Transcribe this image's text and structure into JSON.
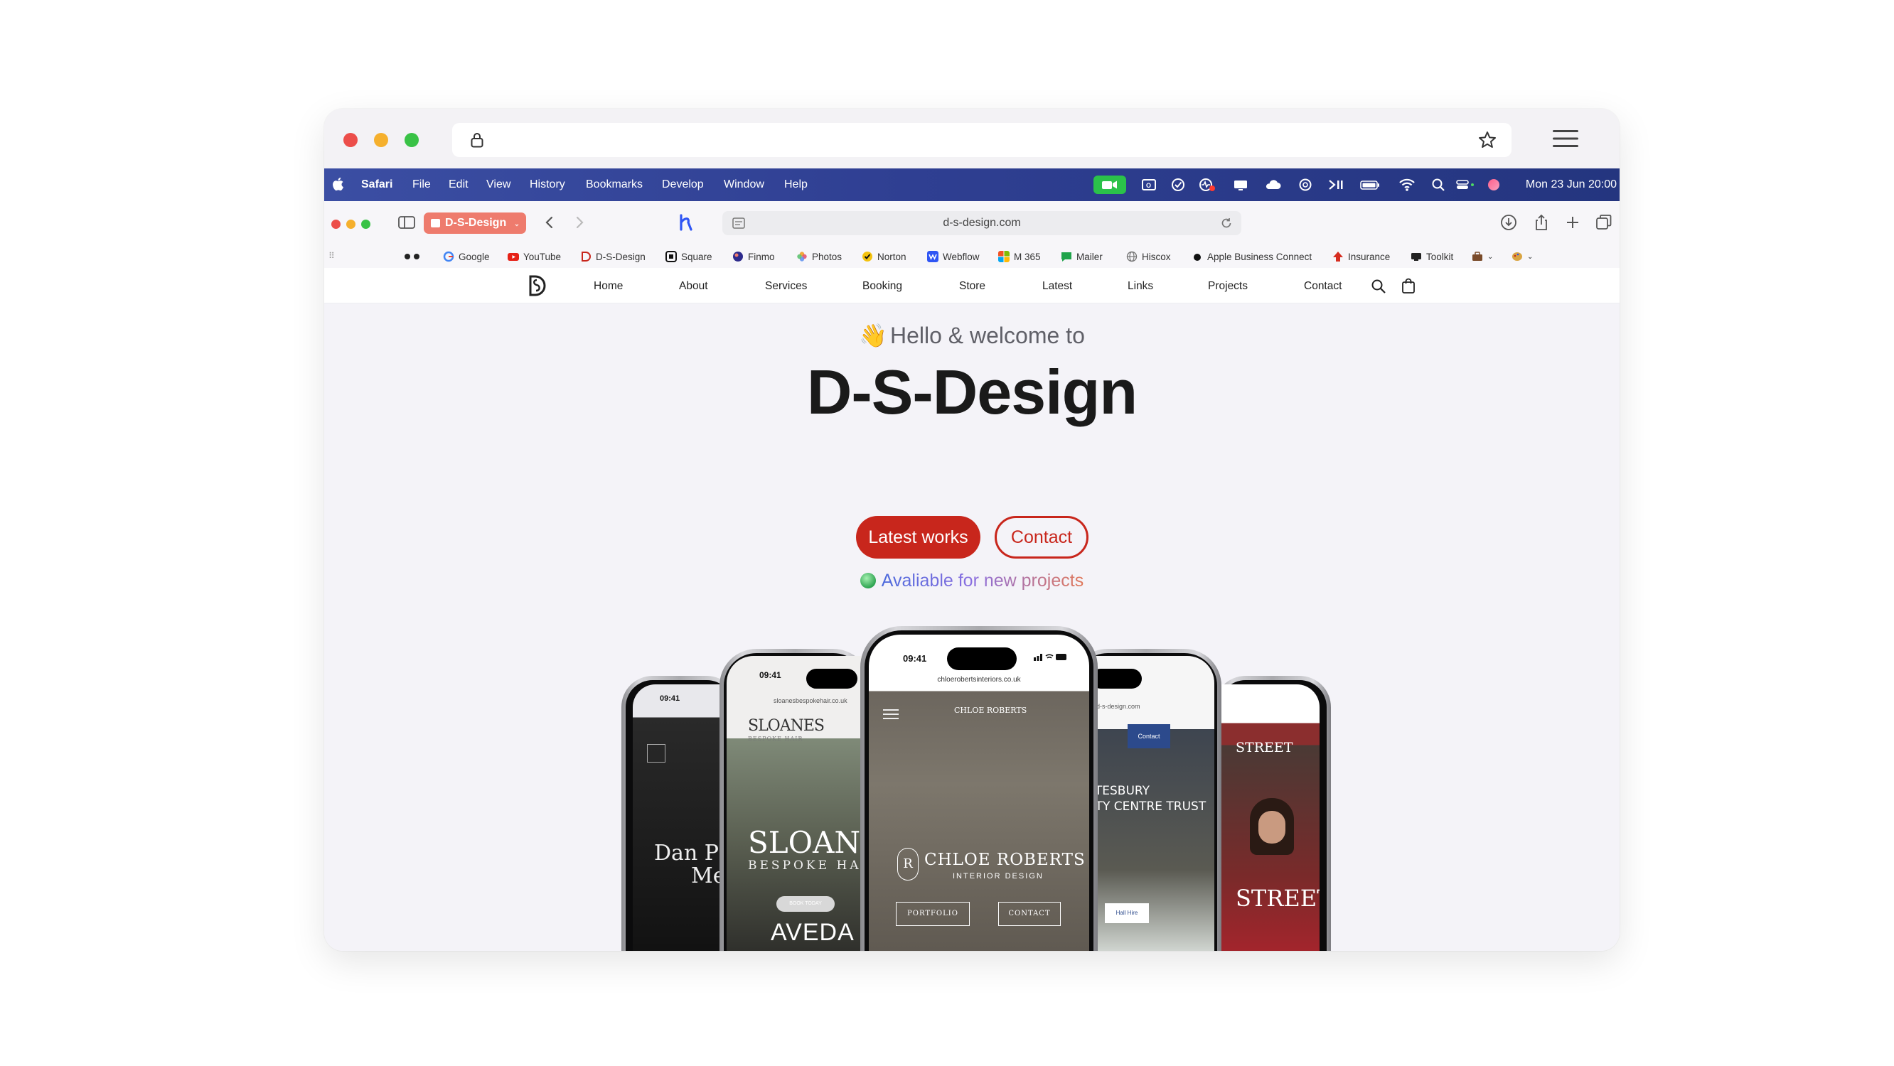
{
  "outer_browser": {},
  "mac_menubar": {
    "app_name": "Safari",
    "menus": [
      "File",
      "Edit",
      "View",
      "History",
      "Bookmarks",
      "Develop",
      "Window",
      "Help"
    ],
    "clock": "Mon 23 Jun  20:00"
  },
  "safari": {
    "tab_group": "D-S-Design",
    "address": "d-s-design.com"
  },
  "favorites": [
    {
      "label": "Google",
      "icon": "google-icon",
      "color": "#4285f4"
    },
    {
      "label": "YouTube",
      "icon": "youtube-icon",
      "color": "#e62117"
    },
    {
      "label": "D-S-Design",
      "icon": "ds-logo-icon",
      "color": "#c8261c"
    },
    {
      "label": "Square",
      "icon": "square-icon",
      "color": "#111111"
    },
    {
      "label": "Finmo",
      "icon": "finmo-icon",
      "color": "#2d2a8c"
    },
    {
      "label": "Photos",
      "icon": "photos-icon",
      "color": "#f2a93b"
    },
    {
      "label": "Norton",
      "icon": "norton-icon",
      "color": "#f4c20d"
    },
    {
      "label": "Webflow",
      "icon": "webflow-icon",
      "color": "#2f55f4"
    },
    {
      "label": "M 365",
      "icon": "microsoft-icon",
      "color": "#f35325"
    },
    {
      "label": "Mailer",
      "icon": "mailer-icon",
      "color": "#1fa34a"
    },
    {
      "label": "Hiscox",
      "icon": "globe-icon",
      "color": "#777777"
    },
    {
      "label": "Apple Business Connect",
      "icon": "apple-icon",
      "color": "#111111"
    },
    {
      "label": "Insurance",
      "icon": "insurance-icon",
      "color": "#d62d20"
    },
    {
      "label": "Toolkit",
      "icon": "toolkit-icon",
      "color": "#222222"
    }
  ],
  "site_nav": {
    "links": [
      "Home",
      "About",
      "Services",
      "Booking",
      "Store",
      "Latest",
      "Links",
      "Projects",
      "Contact"
    ]
  },
  "hero": {
    "greeting_emoji": "👋",
    "greeting": "Hello & welcome to",
    "title": "D-S-Design",
    "primary_button": "Latest works",
    "secondary_button": "Contact",
    "availability": "Avaliable for new projects",
    "brand_color": "#c8261c"
  },
  "phones": {
    "time": "09:41",
    "center": {
      "url": "chloerobertsinteriors.co.uk",
      "header_brand": "CHLOE ROBERTS",
      "brand": "CHLOE ROBERTS",
      "tagline": "INTERIOR DESIGN",
      "button_1": "PORTFOLIO",
      "button_2": "CONTACT"
    },
    "left": {
      "url": "sloanesbespokehair.co.uk",
      "header_brand": "SLOANES",
      "header_tag": "BESPOKE HAIR",
      "brand": "SLOANE",
      "tagline": "BESPOKE HA",
      "button": "BOOK TODAY",
      "partner": "AVEDA"
    },
    "far_left": {
      "name_1": "Dan P",
      "name_2": "Me"
    },
    "right": {
      "url": "d-s-design.com",
      "nav_button": "Contact",
      "title_1": "HAFTESBURY",
      "title_2": "RINITY CENTRE TRUST",
      "button": "Hall Hire"
    },
    "far_right": {
      "header": "STREET",
      "brand": "STREET"
    }
  }
}
